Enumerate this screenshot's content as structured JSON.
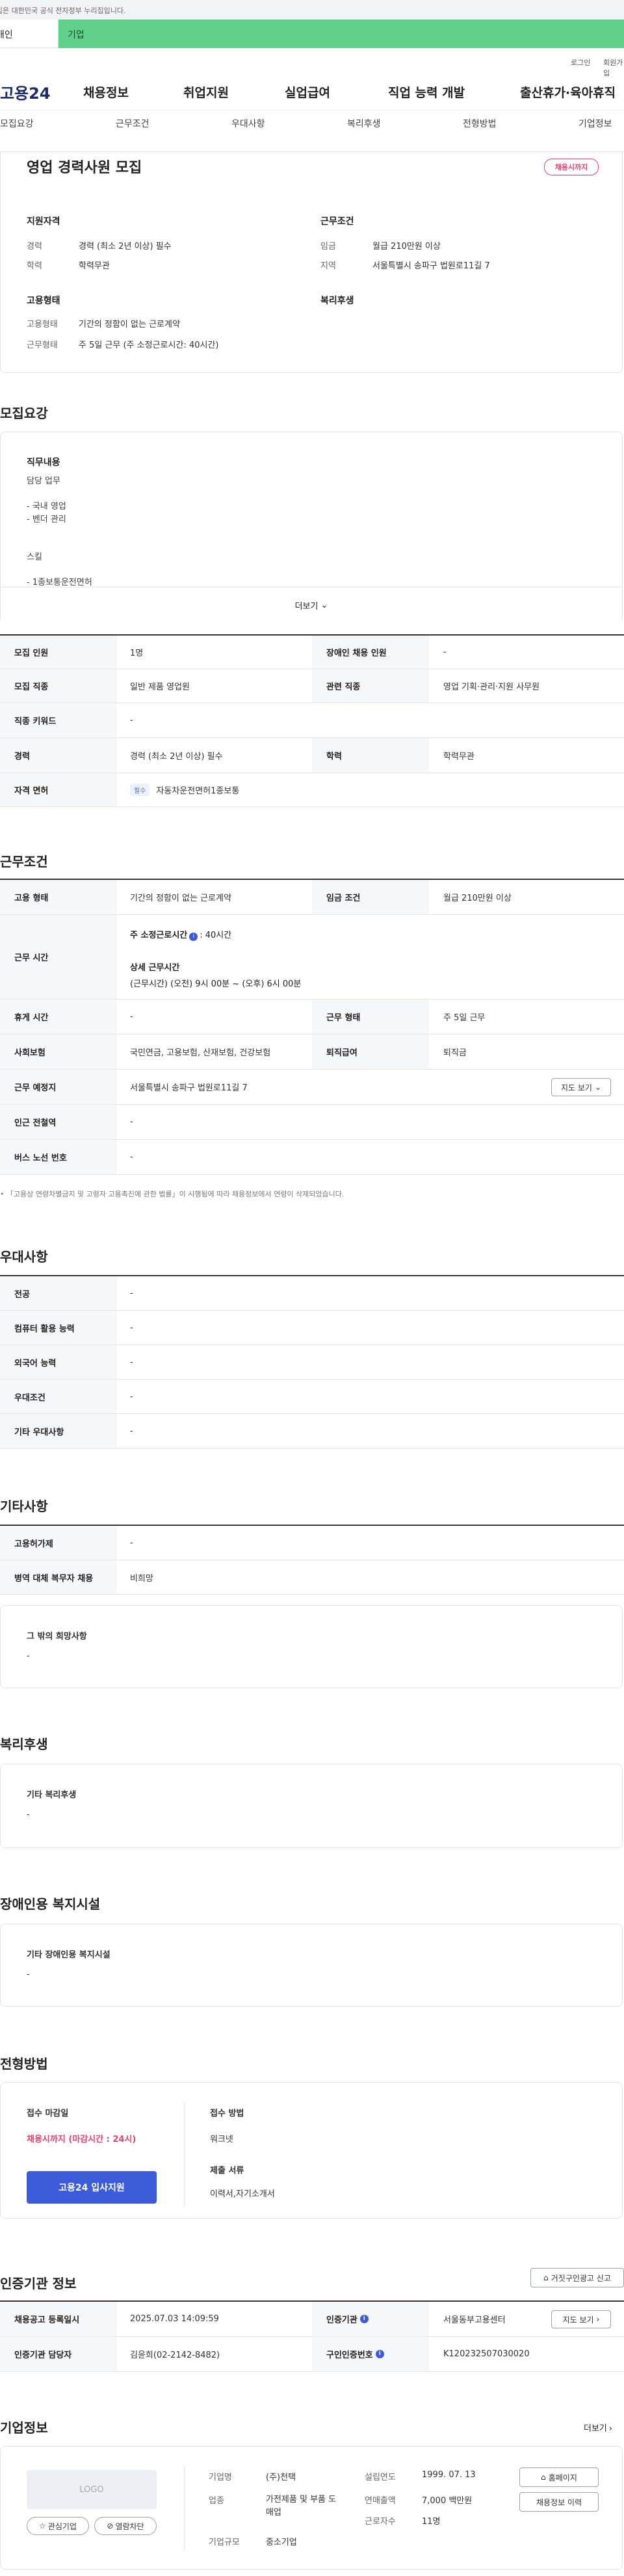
{
  "gov_banner": "이 누리집은 대한민국 공식 전자정부 누리집입니다.",
  "tabs": {
    "personal": "개인",
    "company": "기업"
  },
  "util": {
    "login": "로그인",
    "join": "회원가입"
  },
  "gnb": {
    "logo": "고용24",
    "items": [
      "채용정보",
      "취업지원",
      "실업급여",
      "직업 능력 개발",
      "출산휴가·육아휴직"
    ]
  },
  "subnav": [
    "모집요강",
    "근무조건",
    "우대사항",
    "복리후생",
    "전형방법",
    "기업정보"
  ],
  "job": {
    "title": "영업 경력사원 모집",
    "badge": "채용시까지",
    "qual": {
      "title": "지원자격",
      "career_l": "경력",
      "career_v": "경력 (최소 2년 이상) 필수",
      "edu_l": "학력",
      "edu_v": "학력무관"
    },
    "cond": {
      "title": "근무조건",
      "wage_l": "임금",
      "wage_v": "월급 210만원 이상",
      "area_l": "지역",
      "area_v": "서울특별시 송파구 법원로11길 7"
    },
    "emp": {
      "title": "고용형태",
      "type_l": "고용형태",
      "type_v": "기간의 정함이 없는 근로계약",
      "form_l": "근무형태",
      "form_v": "주 5일 근무 (주 소정근로시간: 40시간)"
    },
    "welfare_title": "복리후생"
  },
  "recruit": {
    "title": "모집요강",
    "duty_title": "직무내용",
    "duty_lines": [
      "담당 업무",
      "",
      "- 국내 영업",
      "- 벤더 관리",
      "",
      "",
      "스킬",
      "",
      "- 1종보통운전면허"
    ],
    "more": "더보기",
    "rows": [
      {
        "a": "모집 인원",
        "av": "1명",
        "b": "장애인 채용 인원",
        "bv": "-"
      },
      {
        "a": "모집 직종",
        "av": "일반 제품 영업원",
        "b": "관련 직종",
        "bv": "영업 기획·관리·지원 사무원"
      },
      {
        "a": "직종 키워드",
        "av": "-"
      },
      {
        "a": "경력",
        "av": "경력 (최소 2년 이상) 필수",
        "b": "학력",
        "bv": "학력무관"
      },
      {
        "a": "자격 면허",
        "tag": "필수",
        "av": "자동차운전면허1종보통"
      }
    ]
  },
  "work": {
    "title": "근무조건",
    "emp_l": "고용 형태",
    "emp_v": "기간의 정함이 없는 근로계약",
    "wage_l": "임금 조건",
    "wage_v": "월급 210만원 이상",
    "time_l": "근무 시간",
    "time_v1": "주 소정근로시간",
    "time_v1b": ": 40시간",
    "time_v2": "상세 근무시간",
    "time_v3": "(근무시간) (오전) 9시 00분 ~ (오후) 6시 00분",
    "rest_l": "휴게 시간",
    "rest_v": "-",
    "form_l": "근무 형태",
    "form_v": "주 5일 근무",
    "ins_l": "사회보험",
    "ins_v": "국민연금, 고용보험, 산재보험, 건강보험",
    "sev_l": "퇴직급여",
    "sev_v": "퇴직금",
    "place_l": "근무 예정지",
    "place_v": "서울특별시 송파구 법원로11길 7",
    "map_btn": "지도 보기",
    "sub_l": "인근 전철역",
    "sub_v": "-",
    "bus_l": "버스 노선 번호",
    "bus_v": "-",
    "note": "• 「고용상 연령차별금지 및 고령자 고용촉진에 관한 법률」이 시행됨에 따라 채용정보에서 연령이 삭제되었습니다."
  },
  "pref": {
    "title": "우대사항",
    "rows": [
      [
        "전공",
        "-"
      ],
      [
        "컴퓨터 활용 능력",
        "-"
      ],
      [
        "외국어 능력",
        "-"
      ],
      [
        "우대조건",
        "-"
      ],
      [
        "기타 우대사항",
        "-"
      ]
    ]
  },
  "etc": {
    "title": "기타사항",
    "rows": [
      [
        "고용허가제",
        "-"
      ],
      [
        "병역 대체 복무자 채용",
        "비희망"
      ]
    ],
    "hope_title": "그 밖의 희망사항",
    "hope_v": "-"
  },
  "welfare": {
    "title": "복리후생",
    "sub": "기타 복리후생",
    "v": "-"
  },
  "disab": {
    "title": "장애인용 복지시설",
    "sub": "기타 장애인용 복지시설",
    "v": "-"
  },
  "select": {
    "title": "전형방법",
    "deadline_l": "접수 마감일",
    "deadline_v": "채용시까지 (마감시간 : 24시)",
    "apply_btn": "고용24 입사지원",
    "method_l": "접수 방법",
    "method_v": "워크넷",
    "docs_l": "제출 서류",
    "docs_v": "이력서,자기소개서"
  },
  "agency": {
    "title": "인증기관 정보",
    "report_btn": "거짓구인광고 신고",
    "reg_l": "채용공고 등록일시",
    "reg_v": "2025.07.03 14:09:59",
    "org_l": "인증기관",
    "org_v": "서울동부고용센터",
    "map_btn": "지도 보기",
    "mgr_l": "인증기관 담당자",
    "mgr_v": "김윤희(02-2142-8482)",
    "no_l": "구인인증번호",
    "no_v": "K120232507030020"
  },
  "company": {
    "title": "기업정보",
    "more": "더보기",
    "logo": "LOGO",
    "fav_btn": "관심기업",
    "block_btn": "열람차단",
    "name_l": "기업명",
    "name_v": "(주)천택",
    "ind_l": "업종",
    "ind_v": "가전제품 및 부품 도매업",
    "size_l": "기업규모",
    "size_v": "중소기업",
    "year_l": "설립연도",
    "year_v": "1999. 07. 13",
    "sales_l": "연매출액",
    "sales_v": "7,000 백만원",
    "emp_l": "근로자수",
    "emp_v": "11명",
    "home_btn": "홈페이지",
    "hist_btn": "채용정보 이력"
  },
  "colors": {
    "accent": "#3b5bdb",
    "tab_green": "#5fd18a",
    "badge": "#e8416a"
  }
}
